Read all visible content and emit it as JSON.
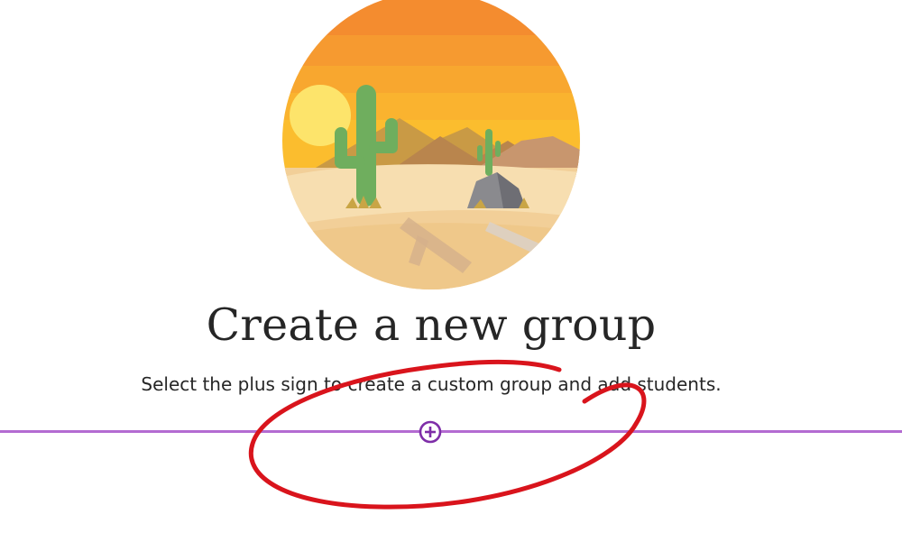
{
  "empty_state": {
    "title": "Create a new group",
    "subtitle": "Select the plus sign to create a custom group and add students."
  },
  "add_group": {
    "icon": "plus-circle-icon",
    "color": "#7e2ea8"
  },
  "divider": {
    "color": "#b36bd1"
  },
  "annotation": {
    "color": "#d9141c"
  },
  "illustration": {
    "subject": "desert-cactus-scene"
  }
}
